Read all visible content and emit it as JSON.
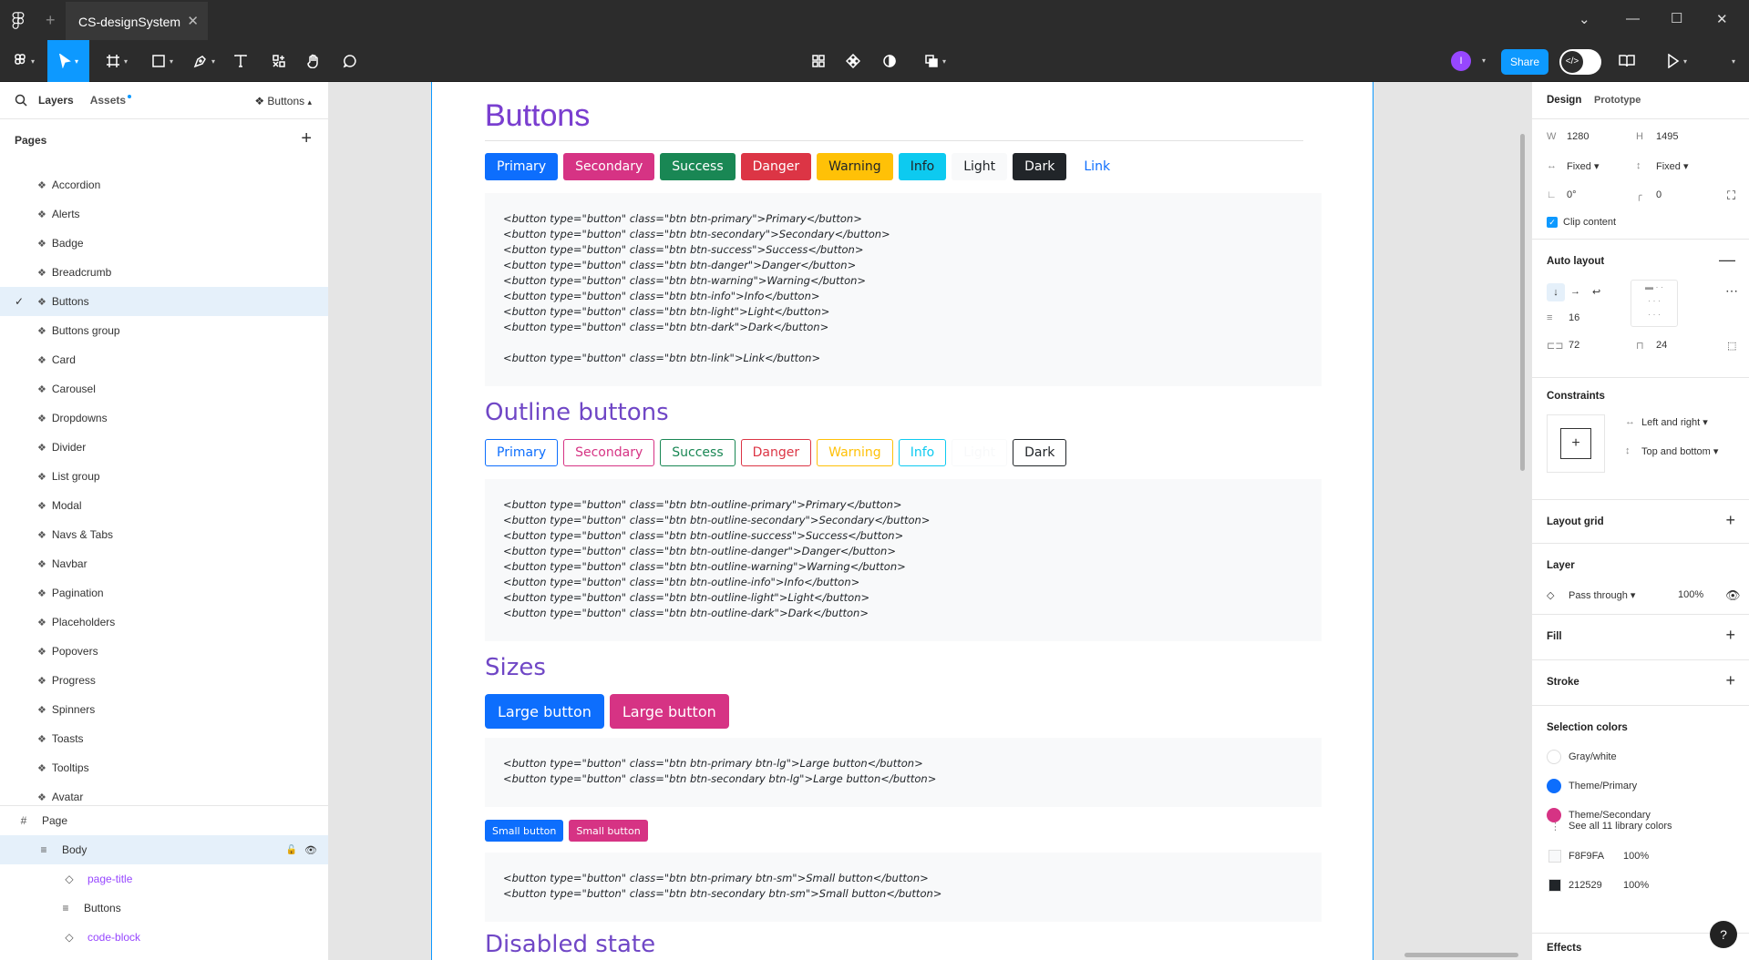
{
  "titlebar": {
    "tab_title": "CS-designSystem"
  },
  "toolbar": {
    "share_label": "Share",
    "avatar_initial": "I"
  },
  "left": {
    "tab_layers": "Layers",
    "tab_assets": "Assets",
    "page_selector": "Buttons",
    "pages_header": "Pages",
    "pages": [
      "Accordion",
      "Alerts",
      "Badge",
      "Breadcrumb",
      "Buttons",
      "Buttons group",
      "Card",
      "Carousel",
      "Dropdowns",
      "Divider",
      "List group",
      "Modal",
      "Navs & Tabs",
      "Navbar",
      "Pagination",
      "Placeholders",
      "Popovers",
      "Progress",
      "Spinners",
      "Toasts",
      "Tooltips",
      "Avatar"
    ],
    "selected_page": "Buttons",
    "layers": [
      {
        "name": "Page",
        "icon": "frame-icon"
      },
      {
        "name": "Body",
        "icon": "autolayout-icon"
      },
      {
        "name": "page-title",
        "icon": "instance-icon"
      },
      {
        "name": "Buttons",
        "icon": "autolayout-icon"
      },
      {
        "name": "code-block",
        "icon": "instance-icon"
      }
    ]
  },
  "canvas": {
    "title_buttons": "Buttons",
    "buttons": [
      {
        "label": "Primary",
        "bg": "#0d6efd",
        "fg": "#ffffff"
      },
      {
        "label": "Secondary",
        "bg": "#d63384",
        "fg": "#ffffff"
      },
      {
        "label": "Success",
        "bg": "#198754",
        "fg": "#ffffff"
      },
      {
        "label": "Danger",
        "bg": "#dc3545",
        "fg": "#ffffff"
      },
      {
        "label": "Warning",
        "bg": "#ffc107",
        "fg": "#212529"
      },
      {
        "label": "Info",
        "bg": "#0dcaf0",
        "fg": "#212529"
      },
      {
        "label": "Light",
        "bg": "#f8f9fa",
        "fg": "#212529"
      },
      {
        "label": "Dark",
        "bg": "#212529",
        "fg": "#ffffff"
      },
      {
        "label": "Link",
        "bg": "transparent",
        "fg": "#0d6efd"
      }
    ],
    "code_buttons": "<button type=\"button\" class=\"btn btn-primary\">Primary</button>\n<button type=\"button\" class=\"btn btn-secondary\">Secondary</button>\n<button type=\"button\" class=\"btn btn-success\">Success</button>\n<button type=\"button\" class=\"btn btn-danger\">Danger</button>\n<button type=\"button\" class=\"btn btn-warning\">Warning</button>\n<button type=\"button\" class=\"btn btn-info\">Info</button>\n<button type=\"button\" class=\"btn btn-light\">Light</button>\n<button type=\"button\" class=\"btn btn-dark\">Dark</button>\n\n<button type=\"button\" class=\"btn btn-link\">Link</button>",
    "title_outline": "Outline buttons",
    "outline_buttons": [
      {
        "label": "Primary",
        "color": "#0d6efd"
      },
      {
        "label": "Secondary",
        "color": "#d63384"
      },
      {
        "label": "Success",
        "color": "#198754"
      },
      {
        "label": "Danger",
        "color": "#dc3545"
      },
      {
        "label": "Warning",
        "color": "#ffc107"
      },
      {
        "label": "Info",
        "color": "#0dcaf0"
      },
      {
        "label": "Light",
        "color": "#f8f9fa"
      },
      {
        "label": "Dark",
        "color": "#212529"
      }
    ],
    "code_outline": "<button type=\"button\" class=\"btn btn-outline-primary\">Primary</button>\n<button type=\"button\" class=\"btn btn-outline-secondary\">Secondary</button>\n<button type=\"button\" class=\"btn btn-outline-success\">Success</button>\n<button type=\"button\" class=\"btn btn-outline-danger\">Danger</button>\n<button type=\"button\" class=\"btn btn-outline-warning\">Warning</button>\n<button type=\"button\" class=\"btn btn-outline-info\">Info</button>\n<button type=\"button\" class=\"btn btn-outline-light\">Light</button>\n<button type=\"button\" class=\"btn btn-outline-dark\">Dark</button>",
    "title_sizes": "Sizes",
    "large_primary": "Large button",
    "large_secondary": "Large button",
    "code_large": "<button type=\"button\" class=\"btn btn-primary btn-lg\">Large button</button>\n<button type=\"button\" class=\"btn btn-secondary btn-lg\">Large button</button>",
    "small_primary": "Small button",
    "small_secondary": "Small button",
    "code_small": "<button type=\"button\" class=\"btn btn-primary btn-sm\">Small button</button>\n<button type=\"button\" class=\"btn btn-secondary btn-sm\">Small button</button>",
    "title_disabled": "Disabled state"
  },
  "right": {
    "tab_design": "Design",
    "tab_prototype": "Prototype",
    "w_label": "W",
    "w_value": "1280",
    "h_label": "H",
    "h_value": "1495",
    "w_mode": "Fixed",
    "h_mode": "Fixed",
    "rotation": "0°",
    "radius": "0",
    "clip_content": "Clip content",
    "auto_layout": "Auto layout",
    "gap": "16",
    "padding_h": "72",
    "padding_v": "24",
    "constraints": "Constraints",
    "constraint_h": "Left and right",
    "constraint_v": "Top and bottom",
    "layout_grid": "Layout grid",
    "layer": "Layer",
    "blend": "Pass through",
    "opacity": "100%",
    "fill": "Fill",
    "stroke": "Stroke",
    "selection_colors": "Selection colors",
    "colors": [
      {
        "name": "Gray/white",
        "hex": "#ffffff"
      },
      {
        "name": "Theme/Primary",
        "hex": "#0d6efd"
      },
      {
        "name": "Theme/Secondary",
        "hex": "#d63384"
      }
    ],
    "see_all": "See all 11 library colors",
    "raw_colors": [
      {
        "hex_label": "F8F9FA",
        "hex": "#F8F9FA",
        "opacity": "100%"
      },
      {
        "hex_label": "212529",
        "hex": "#212529",
        "opacity": "100%"
      }
    ],
    "effects": "Effects",
    "help": "?"
  }
}
